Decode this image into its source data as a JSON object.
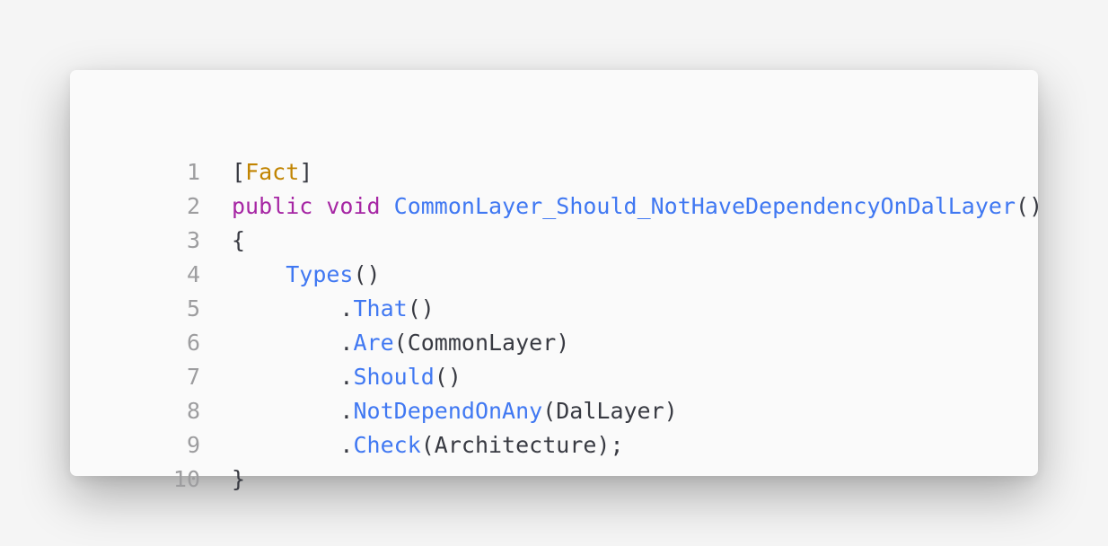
{
  "code_snippet": {
    "colors": {
      "background": "#fafafa",
      "page": "#f5f5f5",
      "line_number": "#9d9d9f",
      "plain": "#383a42",
      "attribute": "#c18401",
      "keyword": "#a626a4",
      "function": "#4078f2"
    },
    "lines": [
      {
        "number": "1",
        "indent": "",
        "tokens": [
          {
            "text": "[",
            "kind": "plain"
          },
          {
            "text": "Fact",
            "kind": "attribute"
          },
          {
            "text": "]",
            "kind": "plain"
          }
        ]
      },
      {
        "number": "2",
        "indent": "",
        "tokens": [
          {
            "text": "public",
            "kind": "keyword"
          },
          {
            "text": " ",
            "kind": "plain"
          },
          {
            "text": "void",
            "kind": "keyword"
          },
          {
            "text": " ",
            "kind": "plain"
          },
          {
            "text": "CommonLayer_Should_NotHaveDependencyOnDalLayer",
            "kind": "function"
          },
          {
            "text": "()",
            "kind": "plain"
          }
        ]
      },
      {
        "number": "3",
        "indent": "",
        "tokens": [
          {
            "text": "{",
            "kind": "plain"
          }
        ]
      },
      {
        "number": "4",
        "indent": "    ",
        "tokens": [
          {
            "text": "Types",
            "kind": "function"
          },
          {
            "text": "()",
            "kind": "plain"
          }
        ]
      },
      {
        "number": "5",
        "indent": "        ",
        "tokens": [
          {
            "text": ".",
            "kind": "plain"
          },
          {
            "text": "That",
            "kind": "function"
          },
          {
            "text": "()",
            "kind": "plain"
          }
        ]
      },
      {
        "number": "6",
        "indent": "        ",
        "tokens": [
          {
            "text": ".",
            "kind": "plain"
          },
          {
            "text": "Are",
            "kind": "function"
          },
          {
            "text": "(CommonLayer)",
            "kind": "plain"
          }
        ]
      },
      {
        "number": "7",
        "indent": "        ",
        "tokens": [
          {
            "text": ".",
            "kind": "plain"
          },
          {
            "text": "Should",
            "kind": "function"
          },
          {
            "text": "()",
            "kind": "plain"
          }
        ]
      },
      {
        "number": "8",
        "indent": "        ",
        "tokens": [
          {
            "text": ".",
            "kind": "plain"
          },
          {
            "text": "NotDependOnAny",
            "kind": "function"
          },
          {
            "text": "(DalLayer)",
            "kind": "plain"
          }
        ]
      },
      {
        "number": "9",
        "indent": "        ",
        "tokens": [
          {
            "text": ".",
            "kind": "plain"
          },
          {
            "text": "Check",
            "kind": "function"
          },
          {
            "text": "(Architecture);",
            "kind": "plain"
          }
        ]
      },
      {
        "number": "10",
        "indent": "",
        "tokens": [
          {
            "text": "}",
            "kind": "plain"
          }
        ]
      }
    ]
  }
}
